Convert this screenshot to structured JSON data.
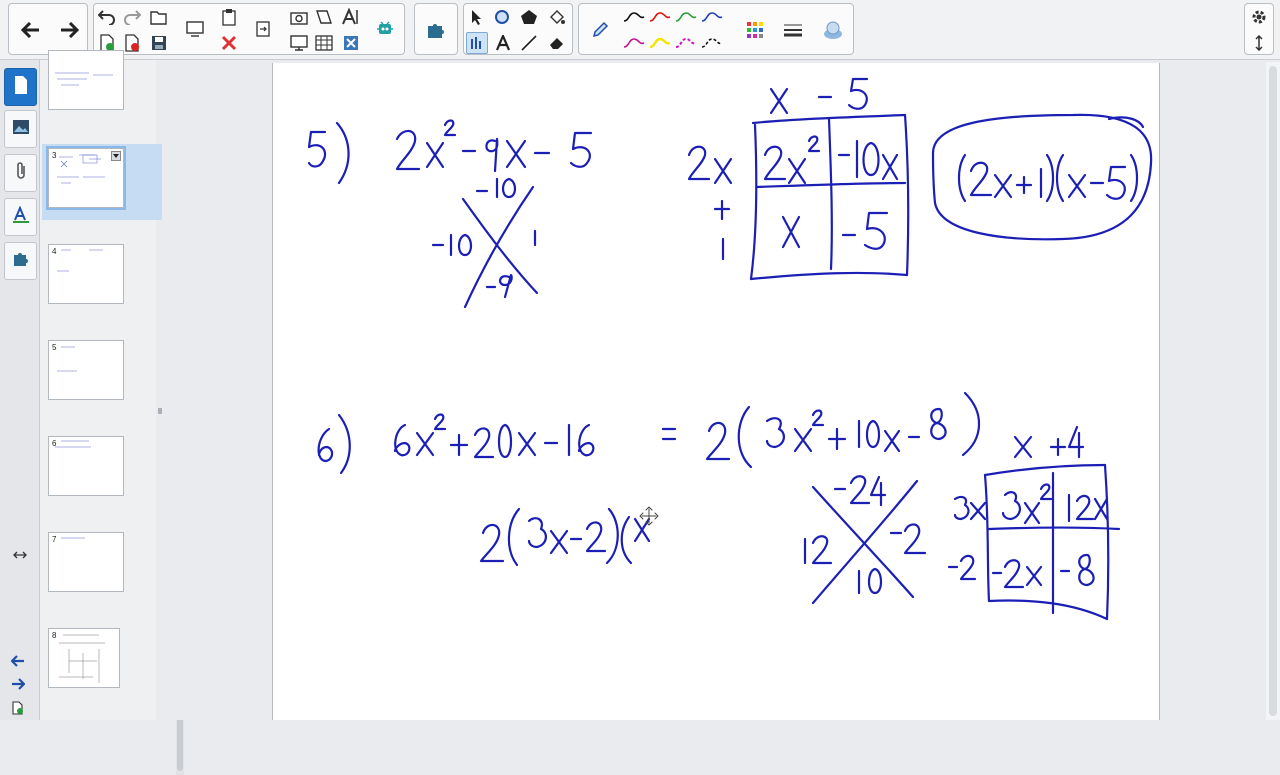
{
  "toolbar": {
    "icons": [
      "back-arrow-icon",
      "forward-arrow-icon",
      "undo-icon",
      "redo-icon",
      "open-file-icon",
      "new-page-icon",
      "delete-page-icon",
      "save-icon",
      "screen-capture-icon",
      "paste-icon",
      "full-screen-icon",
      "camera-icon",
      "screen-shade-icon",
      "text-tool-icon",
      "addon-icon",
      "puzzle-icon",
      "select-icon",
      "shapes-icon",
      "fill-icon",
      "pen-icon",
      "line-icon",
      "eraser-icon",
      "settings-icon",
      "expand-icon"
    ],
    "accent": "#1f74c9"
  },
  "sidebar": {
    "tabs": [
      "page-sorter-icon",
      "gallery-icon",
      "attachments-icon",
      "properties-icon",
      "addons-icon"
    ]
  },
  "sorter": {
    "pages": [
      {
        "label": ""
      },
      {
        "label": "3"
      },
      {
        "label": "4"
      },
      {
        "label": "5"
      },
      {
        "label": "6"
      },
      {
        "label": "7"
      },
      {
        "label": "8"
      }
    ]
  },
  "canvas": {
    "ink_color": "#1b1fb5"
  }
}
